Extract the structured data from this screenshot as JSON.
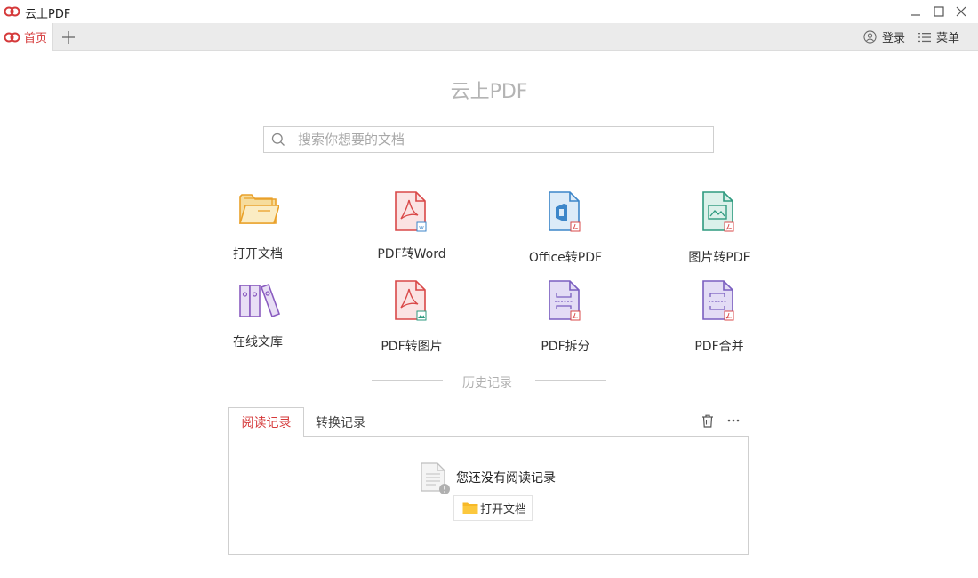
{
  "app": {
    "title": "云上PDF"
  },
  "tabs": {
    "home_label": "首页"
  },
  "toolbar": {
    "login_label": "登录",
    "menu_label": "菜单"
  },
  "main": {
    "title": "云上PDF"
  },
  "search": {
    "placeholder": "搜索你想要的文档"
  },
  "tools": [
    {
      "label": "打开文档",
      "icon": "folder-icon"
    },
    {
      "label": "PDF转Word",
      "icon": "pdf-to-word-icon"
    },
    {
      "label": "Office转PDF",
      "icon": "office-to-pdf-icon"
    },
    {
      "label": "图片转PDF",
      "icon": "image-to-pdf-icon"
    },
    {
      "label": "在线文库",
      "icon": "library-icon"
    },
    {
      "label": "PDF转图片",
      "icon": "pdf-to-image-icon"
    },
    {
      "label": "PDF拆分",
      "icon": "pdf-split-icon"
    },
    {
      "label": "PDF合并",
      "icon": "pdf-merge-icon"
    }
  ],
  "history": {
    "title": "历史记录",
    "tabs": [
      "阅读记录",
      "转换记录"
    ],
    "empty_text": "您还没有阅读记录",
    "open_button_label": "打开文档"
  },
  "colors": {
    "accent_red": "#d5393a",
    "folder_orange": "#f0a934",
    "pdf_red": "#d94848",
    "office_blue": "#3d86c9",
    "image_teal": "#2e9a7f",
    "purple": "#8a5cc0"
  }
}
